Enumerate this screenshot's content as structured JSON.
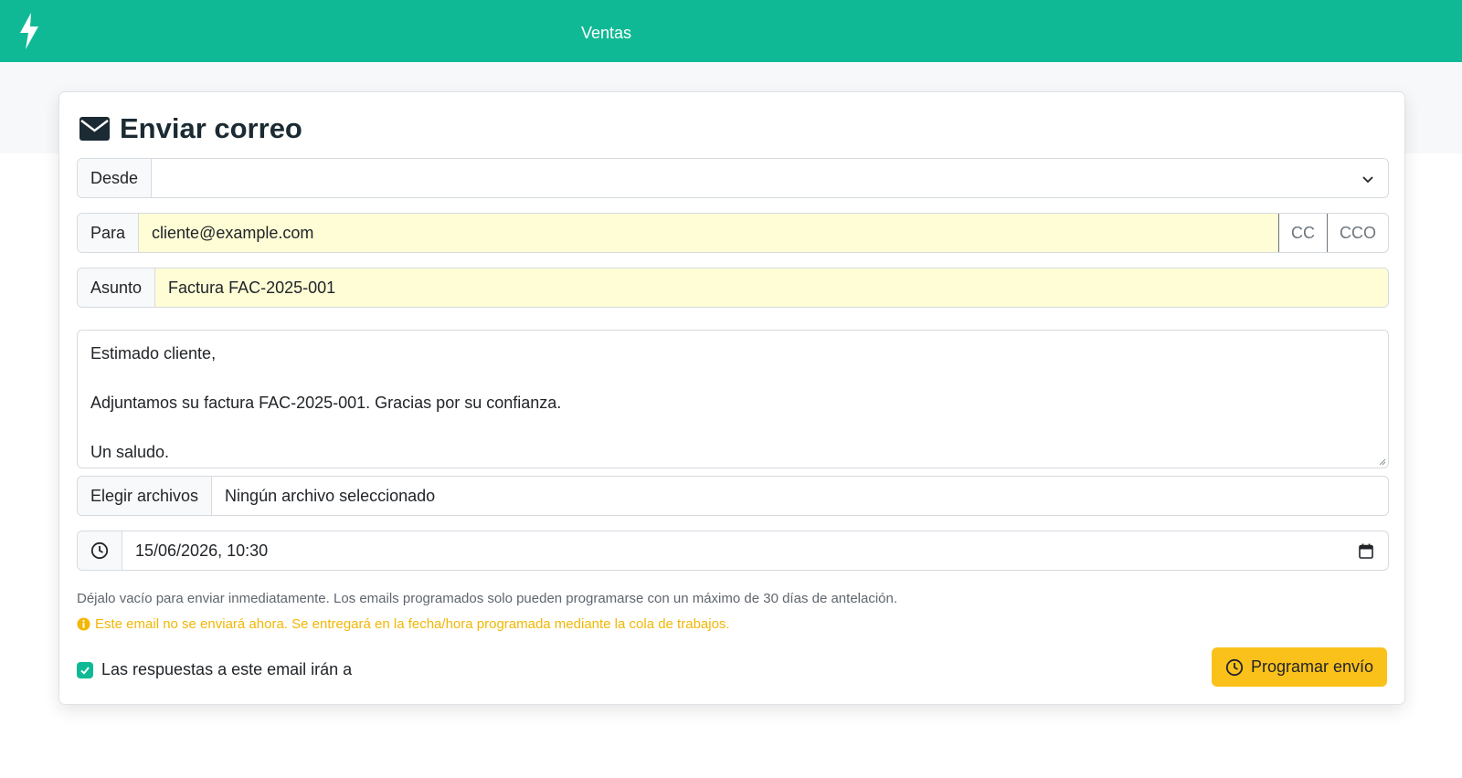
{
  "header": {
    "title": "Ventas",
    "accent_color": "#10b995",
    "logo_icon": "bolt-icon"
  },
  "form": {
    "title": "Enviar correo",
    "title_icon": "envelope-icon",
    "from": {
      "label": "Desde",
      "value": ""
    },
    "to": {
      "label": "Para",
      "value": "cliente@example.com",
      "cc_label": "CC",
      "bcc_label": "CCO"
    },
    "subject": {
      "label": "Asunto",
      "value": "Factura FAC-2025-001"
    },
    "body_lines": [
      "Estimado cliente,",
      "",
      "Adjuntamos su factura FAC-2025-001. Gracias por su confianza.",
      "",
      "Un saludo."
    ],
    "attachments": {
      "button_label": "Elegir archivos",
      "status": "Ningún archivo seleccionado"
    },
    "schedule": {
      "icon": "clock-icon",
      "value": "15/06/2026, 10:30",
      "help": "Déjalo vacío para enviar inmediatamente. Los emails programados solo pueden programarse con un máximo de 30 días de antelación.",
      "warning": "Este email no se enviará ahora. Se entregará en la fecha/hora programada mediante la cola de trabajos.",
      "warning_color": "#f2b705"
    },
    "reply_to": {
      "label": "Las respuestas a este email irán a",
      "checked": true
    },
    "submit_label": "Programar envío",
    "submit_color": "#fbc11b"
  }
}
